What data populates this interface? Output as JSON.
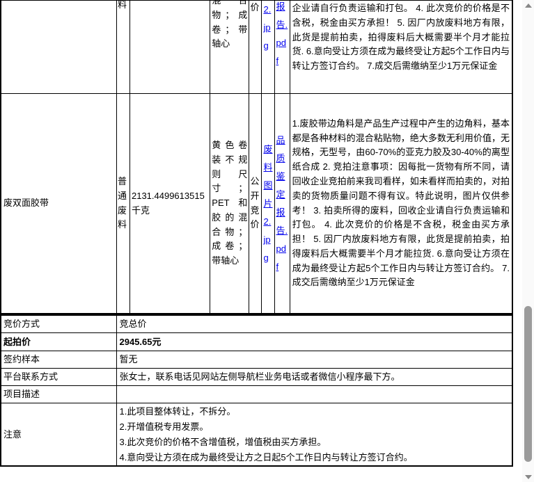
{
  "lot_table": {
    "partial_row": {
      "category_tail": "料",
      "description_tail": "混合物；成卷；带轴心",
      "method_tail": "价",
      "image_link_tail": "2.jpg",
      "report_link_tail": "报告.pdf",
      "notes_tail": "企业请自行负责运输和打包。 4. 此次竞价的价格是不含税，税金由买方承担！ 5. 因厂内放废料地方有限，此货是提前拍卖，拍得废料后大概需要半个月才能拉货. 6.意向受让方须在成为最终受让方起5个工作日内与转让方签订合约。 7.成交后需缴纳至少1万元保证金"
    },
    "row": {
      "name": "废双面胶带",
      "category": "普通废料",
      "quantity": "2131.4499613515千克",
      "description": "黄色卷装不规则尺寸；PET和胶的混合物；成卷；带轴心",
      "method": "公开竞价",
      "image_link": "废料图片2.jpg",
      "report_link": "品质鉴定报告.pdf",
      "notes": "1.废胶带边角料是产品生产过程中产生的边角料，基本都是各种材料的混合粘贴物，绝大多数无利用价值，无规格，无型号，由60-70%的亚克力胶及30-40%的离型纸合成 2. 竞拍注意事项：因每批一货物有所不同，请回收企业竞拍前来我司看样，如未看样而拍卖的，对拍卖的货物质量问题不得有议。特此说明，图片仅供参考！ 3. 拍卖所得的废料，回收企业请自行负责运输和打包。 4. 此次竞价的价格是不含税，税金由买方承担！ 5. 因厂内放废料地方有限，此货是提前拍卖，拍得废料后大概需要半个月才能拉货. 6.意向受让方须在成为最终受让方起5个工作日内与转让方签订合约。 7.成交后需缴纳至少1万元保证金"
    }
  },
  "info_table": {
    "rows": [
      {
        "label": "竞价方式",
        "value": "竞总价"
      },
      {
        "label": "起拍价",
        "value": "2945.65元"
      },
      {
        "label": "签约样本",
        "value": "暂无"
      },
      {
        "label": "平台联系方式",
        "value": "张女士，联系电话见网站左侧导航栏业务电话或者微信小程序最下方。"
      },
      {
        "label": "项目描述",
        "value": ""
      },
      {
        "label": "注意",
        "lines": [
          "1.此项目整体转让，不拆分。",
          "2.开增值税专用发票。",
          "3.此次竞价的价格不含增值税，增值税由买方承担。",
          "4.意向受让方须在成为最终受让方之日起5个工作日内与转让方签订合约。"
        ]
      }
    ]
  },
  "colors": {
    "link": "#0000EE",
    "border": "#000000",
    "scrollbar_thumb": "#9b9b9b",
    "scrollbar_arrow": "#888888"
  }
}
